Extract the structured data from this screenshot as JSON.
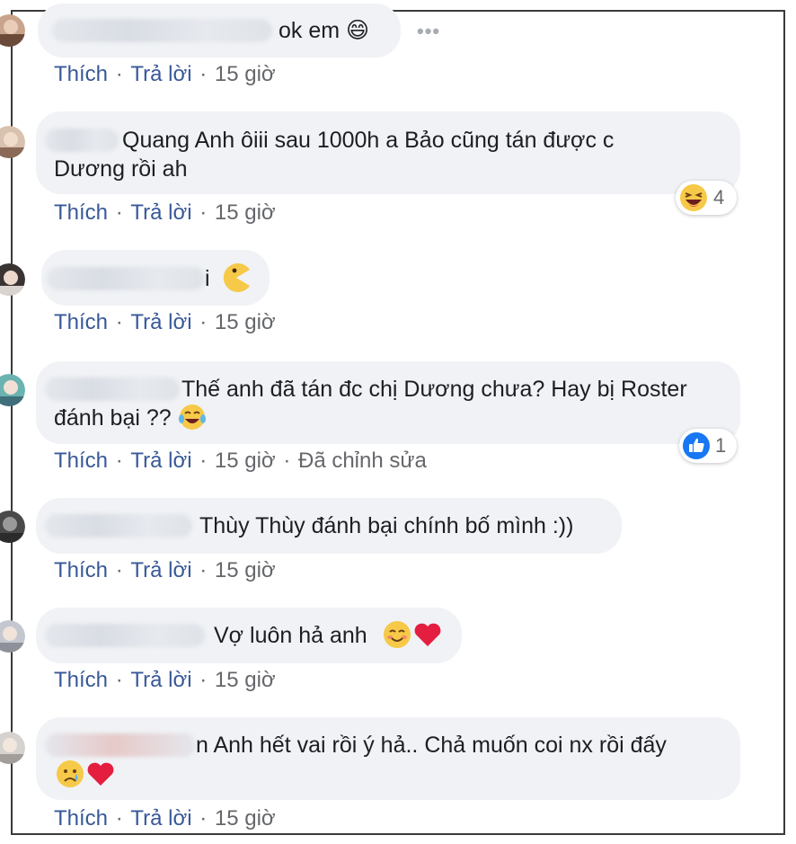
{
  "comments": [
    {
      "text": "ok em 😄",
      "meta": {
        "like": "Thích",
        "reply": "Trả lời",
        "time": "15 giờ",
        "edited": ""
      }
    },
    {
      "text_line1": "Quang Anh ôiii sau 1000h a Bảo cũng tán được c",
      "text_line2": "Dương rồi ah",
      "reaction": {
        "icon": "laughing-face-icon",
        "count": "4"
      },
      "meta": {
        "like": "Thích",
        "reply": "Trả lời",
        "time": "15 giờ",
        "edited": ""
      }
    },
    {
      "text": "i",
      "meta": {
        "like": "Thích",
        "reply": "Trả lời",
        "time": "15 giờ",
        "edited": ""
      }
    },
    {
      "text_line1": "Thế anh đã tán đc chị Dương chưa? Hay bị Roster",
      "text_line2": "đánh bại ??",
      "reaction": {
        "icon": "like-thumb-icon",
        "count": "1"
      },
      "meta": {
        "like": "Thích",
        "reply": "Trả lời",
        "time": "15 giờ",
        "edited": "Đã chỉnh sửa"
      }
    },
    {
      "text": "Thùy Thùy đánh bại chính bố mình :))",
      "meta": {
        "like": "Thích",
        "reply": "Trả lời",
        "time": "15 giờ",
        "edited": ""
      }
    },
    {
      "text": "Vợ luôn hả anh",
      "meta": {
        "like": "Thích",
        "reply": "Trả lời",
        "time": "15 giờ",
        "edited": ""
      }
    },
    {
      "text_line1": "n Anh hết vai rồi ý hả.. Chả muốn coi nx rồi đấy",
      "meta": {
        "like": "Thích",
        "reply": "Trả lời",
        "time": "15 giờ",
        "edited": ""
      }
    }
  ],
  "colors": {
    "bubble": "#f0f2f5",
    "link": "#385898",
    "meta": "#65676b",
    "like_blue": "#1877f2",
    "heart_red": "#e41e3f",
    "emoji_yellow": "#f7c948"
  }
}
